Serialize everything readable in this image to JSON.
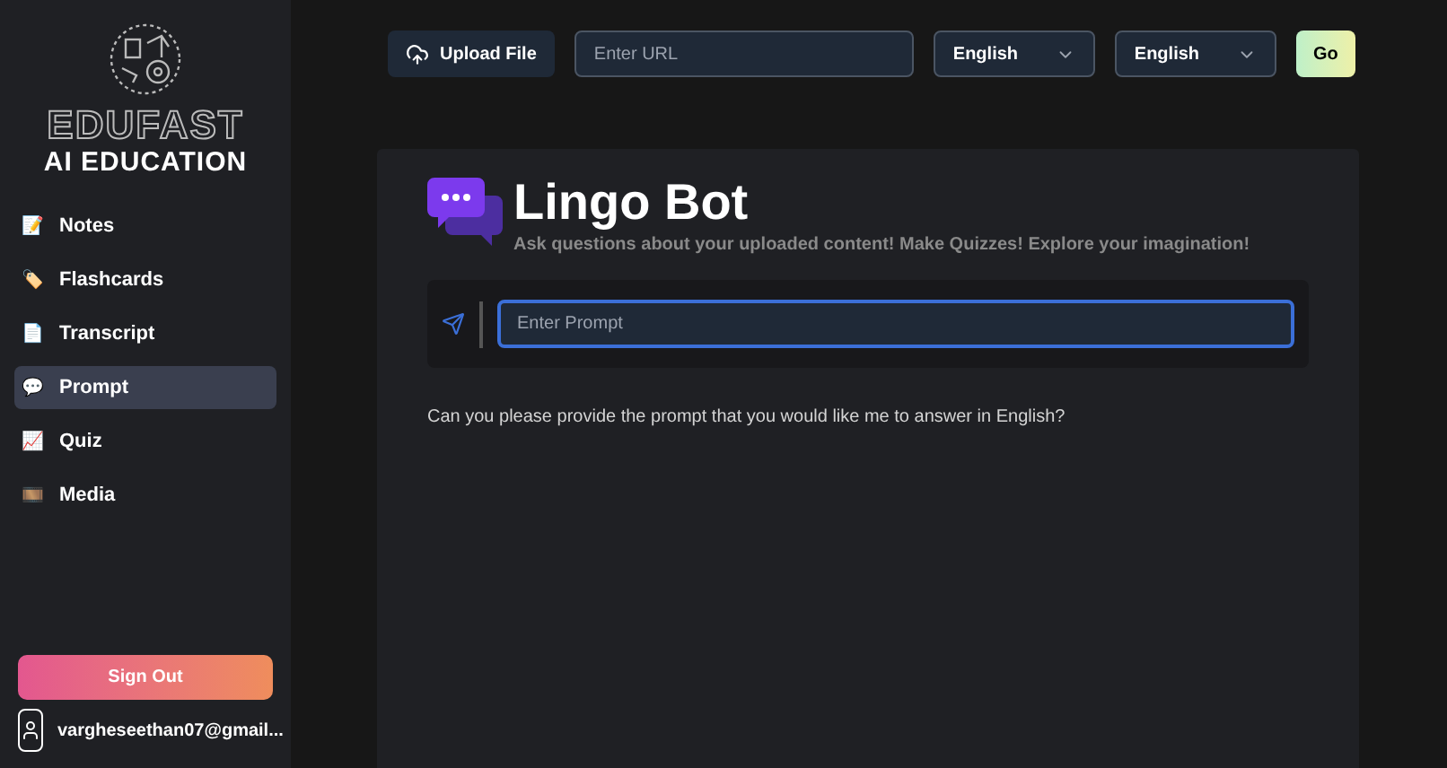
{
  "sidebar": {
    "logo_title": "EDUFAST",
    "logo_subtitle": "AI EDUCATION",
    "items": [
      {
        "icon": "📝",
        "label": "Notes",
        "selected": false
      },
      {
        "icon": "🏷️",
        "label": "Flashcards",
        "selected": false
      },
      {
        "icon": "📄",
        "label": "Transcript",
        "selected": false
      },
      {
        "icon": "💬",
        "label": "Prompt",
        "selected": true
      },
      {
        "icon": "📈",
        "label": "Quiz",
        "selected": false
      },
      {
        "icon": "🎞️",
        "label": "Media",
        "selected": false
      }
    ],
    "sign_out": "Sign Out",
    "user_email": "vargheseethan07@gmail..."
  },
  "toolbar": {
    "upload": "Upload File",
    "url_placeholder": "Enter URL",
    "source_language": "English",
    "target_language": "English",
    "go": "Go"
  },
  "chat": {
    "title": "Lingo Bot",
    "subtitle": "Ask questions about your uploaded content! Make Quizzes! Explore your imagination!",
    "prompt_placeholder": "Enter Prompt",
    "response": "Can you please provide the prompt that you would like me to answer in English?"
  }
}
